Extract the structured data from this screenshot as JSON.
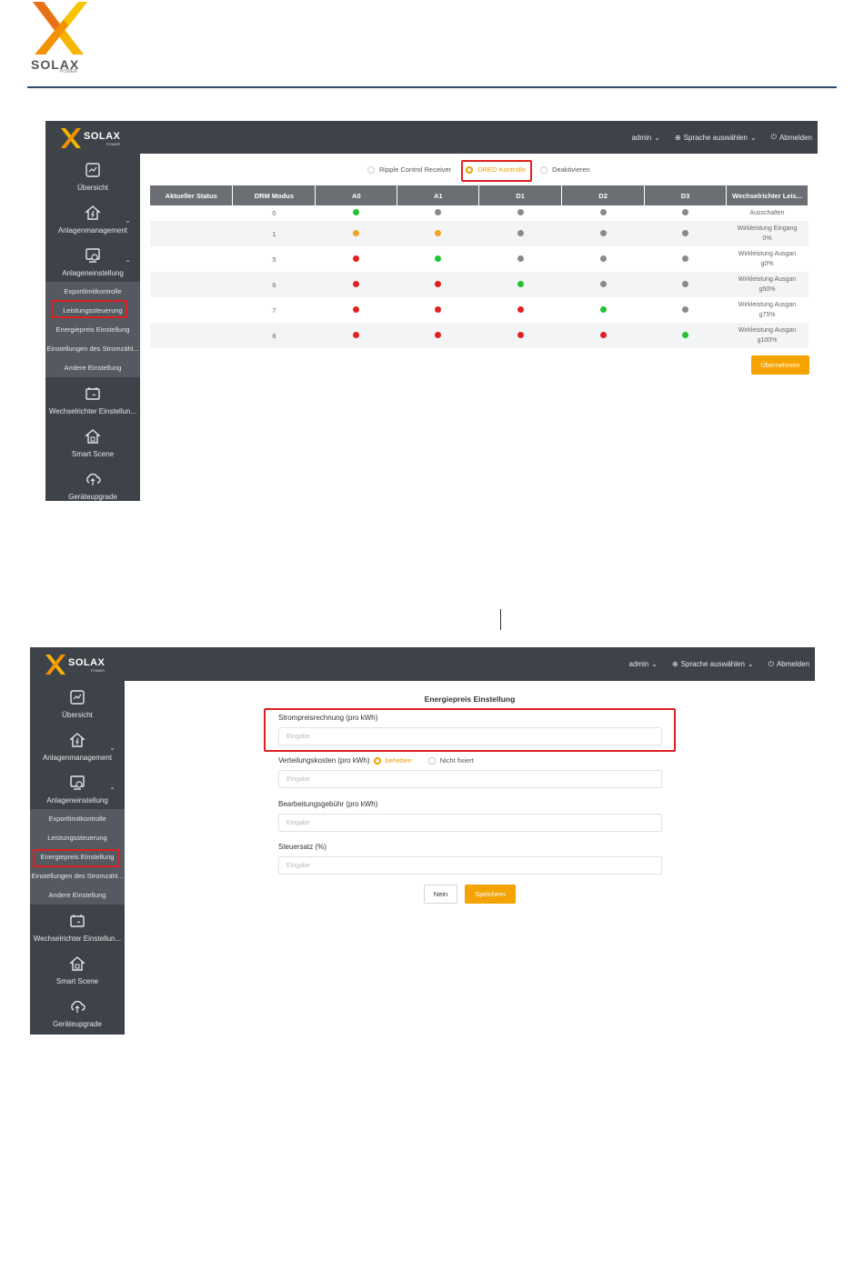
{
  "page": {
    "brand": "SOLAX",
    "brand_sub": "POWER"
  },
  "app": {
    "brand": "SOLAX",
    "brand_sub": "POWER",
    "user": "admin",
    "language": "Sprache auswählen",
    "logout": "Abmelden"
  },
  "shot1": {
    "sidebar": {
      "overview": "Übersicht",
      "plant_mgmt": "Anlagenmanagement",
      "plant_settings": "Anlageneinstellung",
      "export_limit": "Exportlimitkontrolle",
      "power_control": "Leistungssteuerung",
      "energy_price": "Energiepreis Einstellung",
      "meter_settings": "Einstellungen des Stromzähl...",
      "other_settings": "Andere Einstellung",
      "inverter_settings": "Wechselrichter Einstellun...",
      "smart_scene": "Smart Scene",
      "device_upgrade": "Geräteupgrade"
    },
    "radios": {
      "ripple": "Ripple Control Receiver",
      "dred": "DRED Kontrolle",
      "deactivate": "Deaktivieren"
    },
    "table": {
      "headers": [
        "Aktueller Status",
        "DRM Modus",
        "A0",
        "A1",
        "D1",
        "D2",
        "D3",
        "Wechselrichter Leis..."
      ],
      "rows": [
        {
          "mode": "0",
          "leds": [
            "green",
            "gray",
            "gray",
            "gray",
            "gray"
          ],
          "desc1": "Ausschalten",
          "desc2": ""
        },
        {
          "mode": "1",
          "leds": [
            "orange",
            "orange",
            "gray",
            "gray",
            "gray"
          ],
          "desc1": "Wirkleistung Eingang",
          "desc2": "0%"
        },
        {
          "mode": "5",
          "leds": [
            "red",
            "green",
            "gray",
            "gray",
            "gray"
          ],
          "desc1": "Wirkleistung Ausgan",
          "desc2": "g0%"
        },
        {
          "mode": "6",
          "leds": [
            "red",
            "red",
            "green",
            "gray",
            "gray"
          ],
          "desc1": "Wirkleistung Ausgan",
          "desc2": "g50%"
        },
        {
          "mode": "7",
          "leds": [
            "red",
            "red",
            "red",
            "green",
            "gray"
          ],
          "desc1": "Wirkleistung Ausgan",
          "desc2": "g75%"
        },
        {
          "mode": "8",
          "leds": [
            "red",
            "red",
            "red",
            "red",
            "green"
          ],
          "desc1": "Wirkleistung Ausgan",
          "desc2": "g100%"
        }
      ]
    },
    "apply": "Übernehmen"
  },
  "shot2": {
    "sidebar": {
      "overview": "Übersicht",
      "plant_mgmt": "Anlagenmanagement",
      "plant_settings": "Anlageneinstellung",
      "export_limit": "Exportlimitkontrolle",
      "power_control": "Leistungssteuerung",
      "energy_price": "Energiepreis Einstellung",
      "meter_settings": "Einstellungen des Stromzähl...",
      "other_settings": "Andere Einstellung",
      "inverter_settings": "Wechselrichter Einstellun...",
      "smart_scene": "Smart Scene",
      "device_upgrade": "Geräteupgrade"
    },
    "form": {
      "title": "Energiepreis Einstellung",
      "electricity_label": "Strompreisrechnung (pro kWh)",
      "electricity_placeholder": "Eingabe",
      "distribution_label": "Verteilungskosten (pro kWh)",
      "distribution_opt_fixed": "beheben",
      "distribution_opt_not_fixed": "Nicht fixiert",
      "distribution_placeholder": "Eingabe",
      "processing_label": "Bearbeitungsgebühr (pro kWh)",
      "processing_placeholder": "Eingabe",
      "tax_label": "Steuersatz (%)",
      "tax_placeholder": "Eingabe",
      "cancel": "Nein",
      "save": "Speichern"
    }
  },
  "colors": {
    "accent": "#f5a300",
    "topbar": "#3e434a",
    "highlight": "#e02020",
    "led_green": "#22c32e",
    "led_red": "#e32020",
    "led_orange": "#f0a526",
    "led_gray": "#8a8a8a"
  }
}
